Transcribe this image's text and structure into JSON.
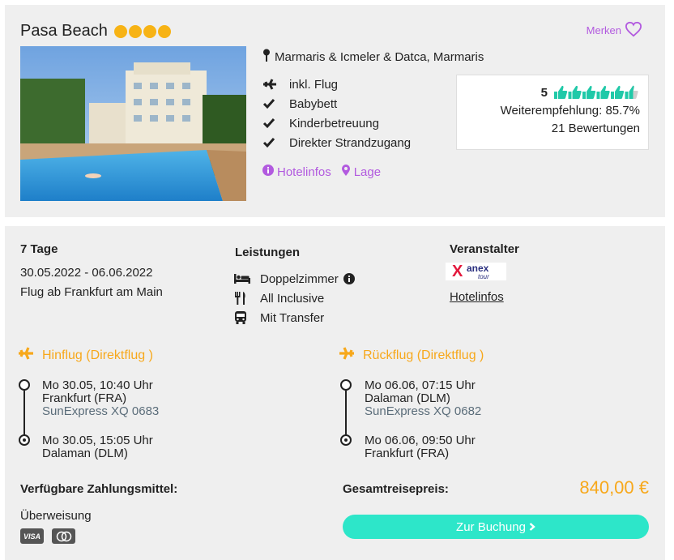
{
  "hotel": {
    "name": "Pasa Beach",
    "star_count": 4,
    "merken_label": "Merken",
    "location": "Marmaris & Icmeler & Datca, Marmaris",
    "features": [
      {
        "icon": "plane-icon",
        "label": "inkl. Flug"
      },
      {
        "icon": "check-icon",
        "label": "Babybett"
      },
      {
        "icon": "check-icon",
        "label": "Kinderbetreuung"
      },
      {
        "icon": "check-icon",
        "label": "Direkter Strandzugang"
      }
    ],
    "links": {
      "hotelinfos": "Hotelinfos",
      "lage": "Lage"
    },
    "rating": {
      "score": "5",
      "thumbs_filled": 5.5,
      "thumbs_total": 6,
      "recommendation": "Weiterempfehlung: 85.7%",
      "reviews": "21 Bewertungen"
    }
  },
  "trip": {
    "duration": "7 Tage",
    "dates": "30.05.2022 - 06.06.2022",
    "departure": "Flug ab Frankfurt am Main"
  },
  "services": {
    "title": "Leistungen",
    "items": [
      {
        "icon": "bed-icon",
        "label": "Doppelzimmer"
      },
      {
        "icon": "cutlery-icon",
        "label": "All Inclusive"
      },
      {
        "icon": "bus-icon",
        "label": "Mit Transfer"
      }
    ]
  },
  "operator": {
    "title": "Veranstalter",
    "logo_text": "anex",
    "logo_subtext": "tour",
    "link": "Hotelinfos"
  },
  "outbound": {
    "title": "Hinflug (Direktflug )",
    "dep_time": "Mo 30.05, 10:40 Uhr",
    "dep_airport": "Frankfurt (FRA)",
    "airline": "SunExpress XQ 0683",
    "arr_time": "Mo 30.05, 15:05 Uhr",
    "arr_airport": "Dalaman (DLM)"
  },
  "inbound": {
    "title": "Rückflug (Direktflug )",
    "dep_time": "Mo 06.06, 07:15 Uhr",
    "dep_airport": "Dalaman (DLM)",
    "airline": "SunExpress XQ 0682",
    "arr_time": "Mo 06.06, 09:50 Uhr",
    "arr_airport": "Frankfurt (FRA)"
  },
  "payment": {
    "title": "Verfügbare Zahlungsmittel:",
    "method": "Überweisung",
    "cards": [
      "VISA",
      "MC"
    ]
  },
  "price": {
    "label": "Gesamtreisepreis:",
    "value": "840,00 €"
  },
  "cta": {
    "label": "Zur Buchung"
  },
  "colors": {
    "accent_orange": "#f7a81b",
    "accent_purple": "#b25adf",
    "button_teal": "#2de6c9",
    "thumb_teal": "#20c9a8"
  }
}
